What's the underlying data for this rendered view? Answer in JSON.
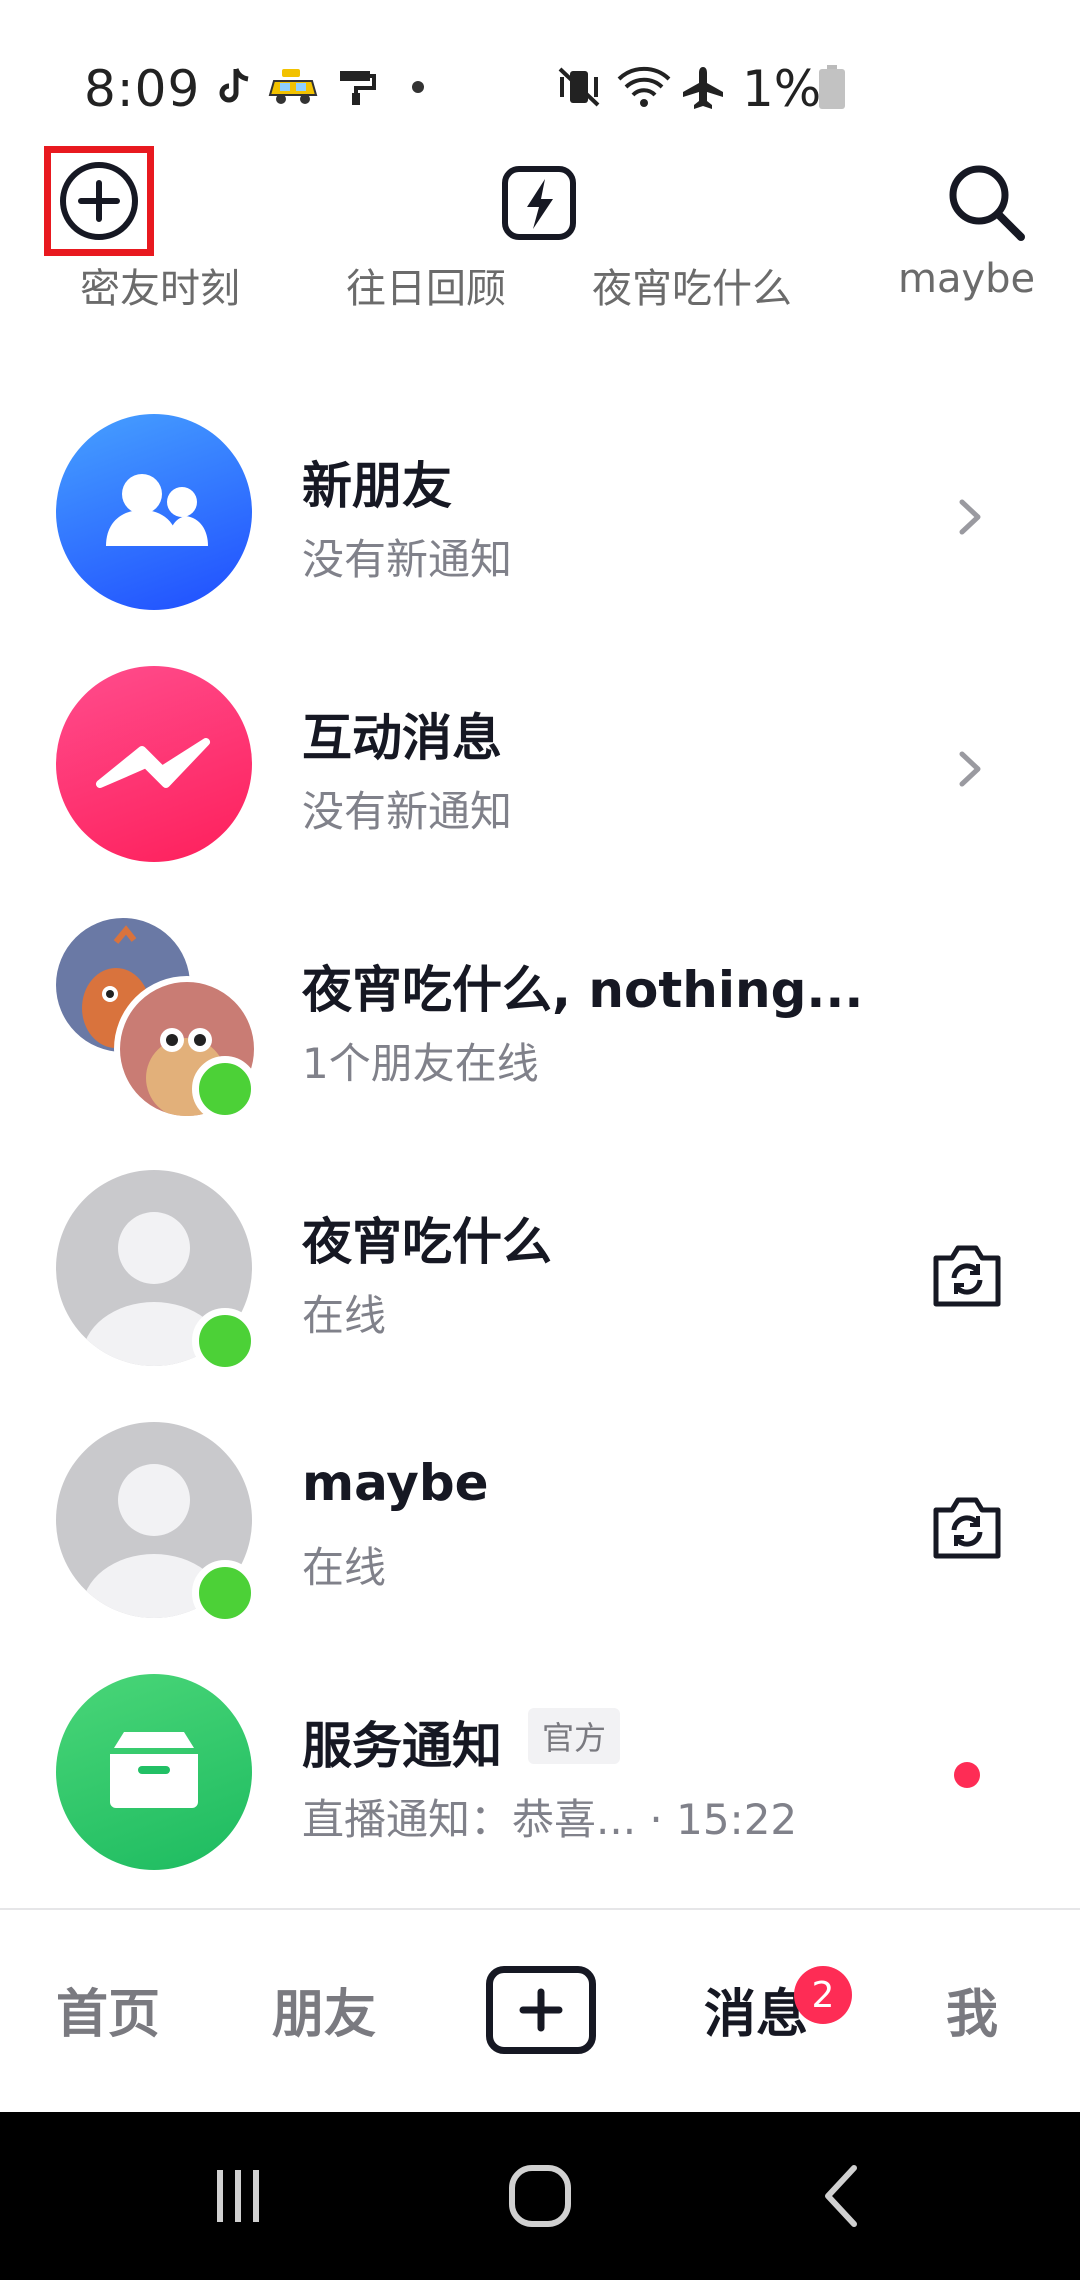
{
  "status_bar": {
    "time": "8:09",
    "battery_percent": "1%",
    "icons": [
      "tiktok-icon",
      "taxi-icon",
      "paint-roller-icon",
      "dot-icon",
      "vibrate-mute-icon",
      "wifi-icon",
      "airplane-icon",
      "battery-icon"
    ]
  },
  "top_bar": {
    "left_icon": "add-circle-icon",
    "center_icon": "flash-icon",
    "right_icon": "search-icon"
  },
  "story_strip": {
    "labels": [
      "密友时刻",
      "往日回顾",
      "夜宵吃什么",
      "maybe"
    ]
  },
  "conversations": [
    {
      "title": "新朋友",
      "subtitle": "没有新通知",
      "avatar": "friends-icon",
      "accessory": "chevron-right-icon",
      "color": "#2f6bff"
    },
    {
      "title": "互动消息",
      "subtitle": "没有新通知",
      "avatar": "interaction-icon",
      "accessory": "chevron-right-icon",
      "color": "#fe2c6e"
    },
    {
      "title": "夜宵吃什么, nothing...",
      "subtitle": "1个朋友在线",
      "avatar": "group-avatar",
      "online": true
    },
    {
      "title": "夜宵吃什么",
      "subtitle": "在线",
      "avatar": "default-user-avatar",
      "online": true,
      "accessory": "camera-icon"
    },
    {
      "title": "maybe",
      "subtitle": "在线",
      "avatar": "default-user-avatar",
      "online": true,
      "accessory": "camera-icon"
    },
    {
      "title": "服务通知",
      "tag": "官方",
      "subtitle": "直播通知：恭喜... · 15:22",
      "avatar": "inbox-icon",
      "unread_dot": true,
      "color": "#2ecc71"
    }
  ],
  "tab_bar": {
    "tabs": [
      "首页",
      "朋友",
      "消息",
      "我"
    ],
    "active": "消息",
    "messages_badge": "2",
    "create_icon": "plus-square-icon"
  },
  "nav_bar": {
    "icons": [
      "recent-apps-icon",
      "home-icon",
      "back-icon"
    ]
  },
  "colors": {
    "accent": "#fe2c55",
    "online": "#4cd137",
    "highlight_box": "#e8191f"
  }
}
